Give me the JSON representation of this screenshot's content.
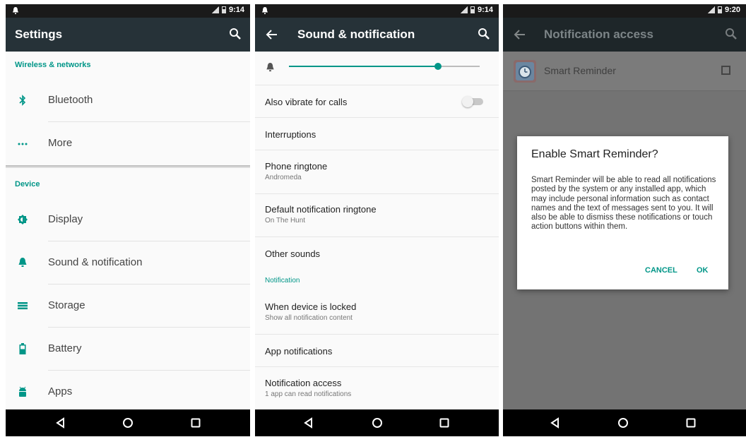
{
  "colors": {
    "accent": "#009688",
    "appbar": "#263238",
    "navbar": "#000000"
  },
  "panel1": {
    "status_time": "9:14",
    "title": "Settings",
    "sections": {
      "wireless": "Wireless & networks",
      "device": "Device"
    },
    "items": [
      {
        "label": "Bluetooth",
        "icon": "bluetooth-icon"
      },
      {
        "label": "More",
        "icon": "more-dots-icon"
      },
      {
        "label": "Display",
        "icon": "brightness-icon"
      },
      {
        "label": "Sound & notification",
        "icon": "bell-icon"
      },
      {
        "label": "Storage",
        "icon": "storage-icon"
      },
      {
        "label": "Battery",
        "icon": "battery-icon"
      },
      {
        "label": "Apps",
        "icon": "android-icon"
      }
    ]
  },
  "panel2": {
    "status_time": "9:14",
    "title": "Sound & notification",
    "ringtone_volume_fraction": 0.78,
    "items": [
      {
        "title": "Also vibrate for calls"
      },
      {
        "title": "Interruptions"
      },
      {
        "title": "Phone ringtone",
        "subtitle": "Andromeda"
      },
      {
        "title": "Default notification ringtone",
        "subtitle": "On The Hunt"
      },
      {
        "title": "Other sounds"
      },
      {
        "title": "When device is locked",
        "subtitle": "Show all notification content"
      },
      {
        "title": "App notifications"
      },
      {
        "title": "Notification access",
        "subtitle": "1 app can read notifications"
      }
    ],
    "section_notification": "Notification"
  },
  "panel3": {
    "status_time": "9:20",
    "title": "Notification access",
    "app_name": "Smart Reminder",
    "dialog": {
      "title": "Enable Smart Reminder?",
      "body": "Smart Reminder will be able to read all notifications posted by the system or any installed app, which may include personal information such as contact names and the text of messages sent to you. It will also be able to dismiss these notifications or touch action buttons within them.",
      "cancel": "CANCEL",
      "ok": "OK"
    }
  }
}
